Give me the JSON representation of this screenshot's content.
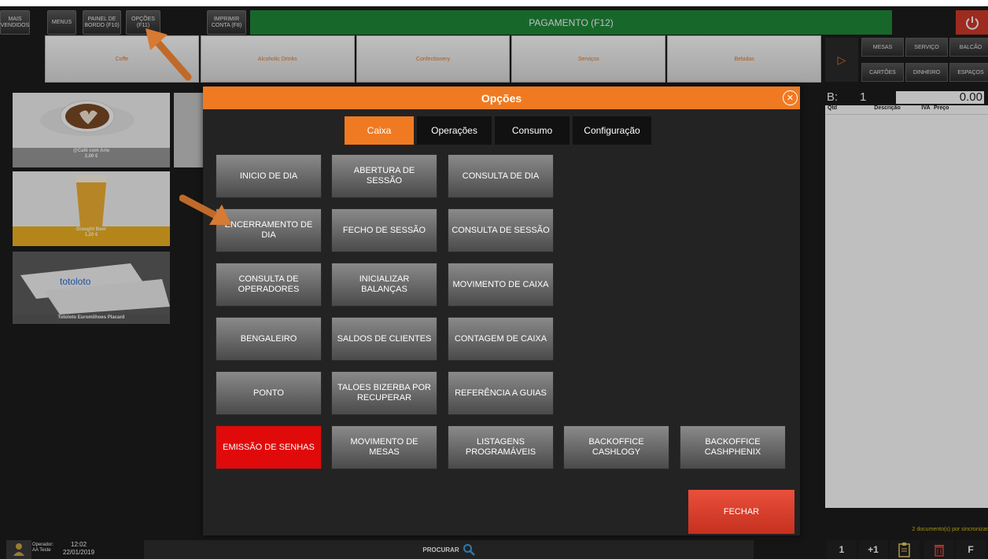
{
  "topbar": {
    "mais_vendidos": "MAIS\nVENDIDOS",
    "menus": "MENUS",
    "painel": "PAINEL DE\nBORDO (F10)",
    "opcoes": "OPÇÕES\n(F11)",
    "imprimir": "IMPRIMIR\nCONTA (F8)",
    "pagamento": "PAGAMENTO (F12)"
  },
  "categories": [
    "Coffe",
    "Alcoholic Drinks",
    "Confectionery",
    "Serviços",
    "Bebidas"
  ],
  "products": [
    {
      "label": "@Café com Arte\n2,00 €"
    },
    {
      "label": "Draught Beer\n1,20 €"
    },
    {
      "label": "Totoloto Euromilhoes Placard"
    }
  ],
  "right_panel": {
    "buttons": [
      "MESAS",
      "SERVIÇO",
      "BALCÃO",
      "CARTÕES",
      "DINHEIRO",
      "ESPAÇOS"
    ],
    "doc_prefix": "B:",
    "doc_number": "1",
    "total": "0.00",
    "columns": [
      "Qtd",
      "Descrição",
      "IVA",
      "Preço"
    ],
    "sync_text": "2 documento(s) por sincronizar"
  },
  "bottom": {
    "operator_label": "Operador:",
    "operator_name": "AA Teste",
    "time": "12:02",
    "date": "22/01/2019",
    "search": "PROCURAR",
    "btn1": "1",
    "btn_plus1": "+1",
    "btn_f": "F"
  },
  "modal": {
    "title": "Opções",
    "tabs": [
      "Caixa",
      "Operações",
      "Consumo",
      "Configuração"
    ],
    "buttons": [
      "INICIO DE DIA",
      "ABERTURA DE SESSÃO",
      "CONSULTA DE DIA",
      "ENCERRAMENTO DE\nDIA",
      "FECHO DE SESSÃO",
      "CONSULTA DE SESSÃO",
      "CONSULTA DE\nOPERADORES",
      "INICIALIZAR BALANÇAS",
      "MOVIMENTO DE CAIXA",
      "BENGALEIRO",
      "SALDOS DE CLIENTES",
      "CONTAGEM DE CAIXA",
      "PONTO",
      "TALOES BIZERBA POR\nRECUPERAR",
      "REFERÊNCIA A GUIAS",
      "EMISSÃO DE SENHAS",
      "MOVIMENTO DE MESAS",
      "LISTAGENS\nPROGRAMÁVEIS",
      "BACKOFFICE\nCASHLOGY",
      "BACKOFFICE\nCASHPHENIX"
    ],
    "close_label": "FECHAR"
  },
  "colors": {
    "accent": "#f07a22",
    "pay_green": "#1f8a3a",
    "danger": "#e10a0a"
  }
}
